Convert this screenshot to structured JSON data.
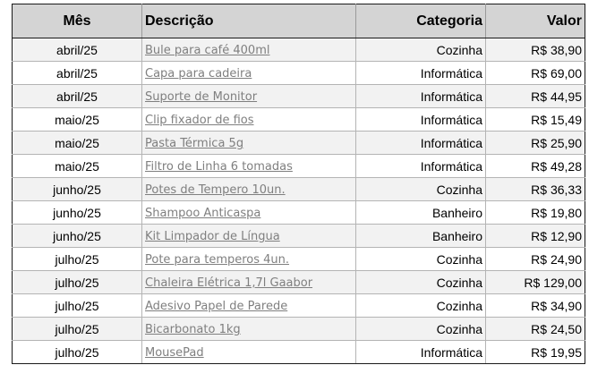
{
  "headers": {
    "mes": "Mês",
    "descricao": "Descrição",
    "categoria": "Categoria",
    "valor": "Valor"
  },
  "rows": [
    {
      "mes": "abril/25",
      "descricao": "Bule para café 400ml",
      "categoria": "Cozinha",
      "valor": "R$ 38,90"
    },
    {
      "mes": "abril/25",
      "descricao": "Capa para cadeira",
      "categoria": "Informática",
      "valor": "R$ 69,00"
    },
    {
      "mes": "abril/25",
      "descricao": "Suporte de Monitor",
      "categoria": "Informática",
      "valor": "R$ 44,95"
    },
    {
      "mes": "maio/25",
      "descricao": "Clip fixador de fios",
      "categoria": "Informática",
      "valor": "R$ 15,49"
    },
    {
      "mes": "maio/25",
      "descricao": "Pasta Térmica 5g",
      "categoria": "Informática",
      "valor": "R$ 25,90"
    },
    {
      "mes": "maio/25",
      "descricao": "Filtro de Linha 6 tomadas",
      "categoria": "Informática",
      "valor": "R$ 49,28"
    },
    {
      "mes": "junho/25",
      "descricao": "Potes de Tempero 10un.",
      "categoria": "Cozinha",
      "valor": "R$ 36,33"
    },
    {
      "mes": "junho/25",
      "descricao": "Shampoo Anticaspa",
      "categoria": "Banheiro",
      "valor": "R$ 19,80"
    },
    {
      "mes": "junho/25",
      "descricao": "Kit Limpador de Língua",
      "categoria": "Banheiro",
      "valor": "R$ 12,90"
    },
    {
      "mes": "julho/25",
      "descricao": "Pote para temperos 4un.",
      "categoria": "Cozinha",
      "valor": "R$ 24,90"
    },
    {
      "mes": "julho/25",
      "descricao": "Chaleira Elétrica 1,7l Gaabor",
      "categoria": "Cozinha",
      "valor": "R$ 129,00"
    },
    {
      "mes": "julho/25",
      "descricao": "Adesivo Papel de Parede",
      "categoria": "Cozinha",
      "valor": "R$ 34,90"
    },
    {
      "mes": "julho/25",
      "descricao": "Bicarbonato 1kg",
      "categoria": "Cozinha",
      "valor": "R$ 24,50"
    },
    {
      "mes": "julho/25",
      "descricao": "MousePad",
      "categoria": "Informática",
      "valor": "R$ 19,95"
    }
  ],
  "colors": {
    "header_bg": "#d4d4d4",
    "band_bg": "#f2f2f2",
    "link_text": "#7f7f7f",
    "grid_line": "#b4b4b4",
    "outer_border": "#1a1a1a"
  }
}
